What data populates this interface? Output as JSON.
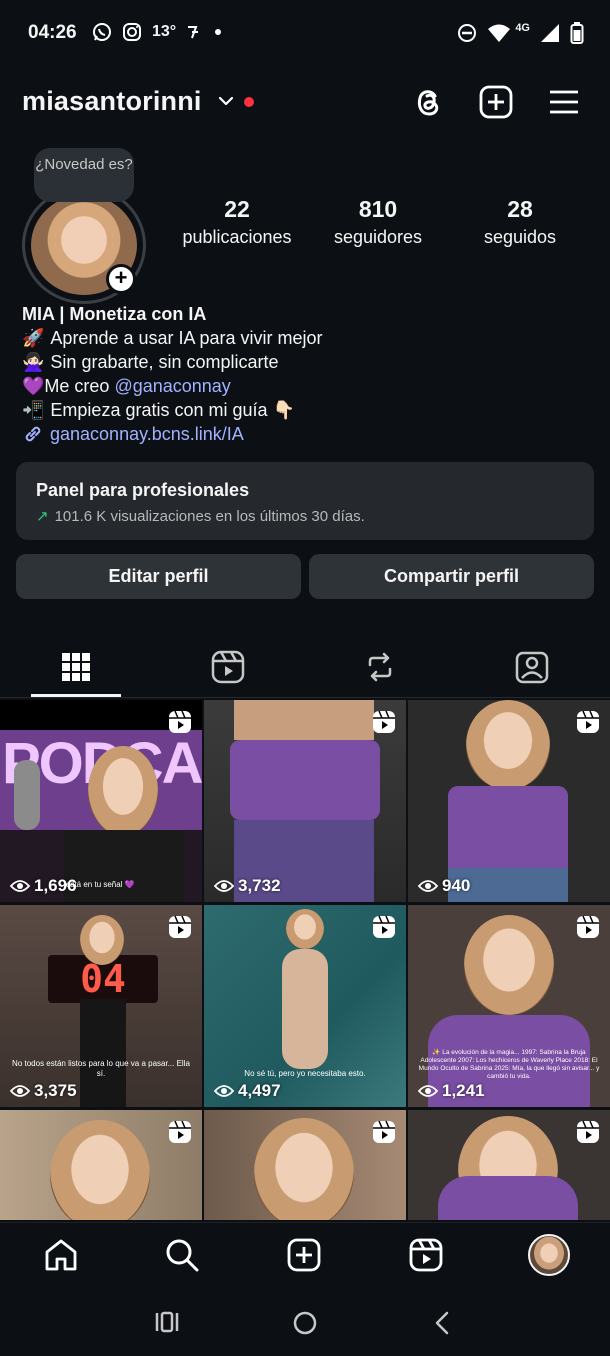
{
  "status_bar": {
    "time": "04:26",
    "temperature": "13°",
    "network": "4G",
    "icons": [
      "whatsapp-icon",
      "instagram-icon",
      "notification-icon",
      "dot-icon",
      "dnd-icon",
      "wifi-icon",
      "signal-icon",
      "battery-icon"
    ]
  },
  "header": {
    "username": "miasantorinni",
    "icons": [
      "threads-icon",
      "new-post-icon",
      "menu-icon"
    ]
  },
  "profile": {
    "note_bubble": "¿Novedad es?",
    "stats": [
      {
        "value": "22",
        "label": "publicaciones"
      },
      {
        "value": "810",
        "label": "seguidores"
      },
      {
        "value": "28",
        "label": "seguidos"
      }
    ],
    "bio": {
      "name": "MIA | Monetiza con IA",
      "line1_emoji": "🚀",
      "line1": "Aprende a usar IA para vivir mejor",
      "line2_emoji": "🙅🏻‍♀️",
      "line2": "Sin grabarte, sin complicarte",
      "line3_emoji": "💜",
      "line3_prefix": "Me creo ",
      "line3_mention": "@ganaconnay",
      "line4_emoji": "📲",
      "line4": "Empieza gratis con mi guía 👇🏻",
      "link": "ganaconnay.bcns.link/IA"
    }
  },
  "panel": {
    "title": "Panel para profesionales",
    "subtitle": "101.6 K visualizaciones en los últimos 30 días."
  },
  "buttons": {
    "edit": "Editar perfil",
    "share": "Compartir perfil"
  },
  "tabs": [
    "grid-icon",
    "reels-icon",
    "reposts-icon",
    "tagged-icon"
  ],
  "grid": [
    {
      "views": "1,696",
      "caption": "está en tu señal 💜",
      "overlay_text": "PODCAN"
    },
    {
      "views": "3,732"
    },
    {
      "views": "940"
    },
    {
      "views": "3,375",
      "caption": "No todos están listos para lo que va a pasar... Ella sí.",
      "overlay_text": "04"
    },
    {
      "views": "4,497",
      "caption": "No sé tú, pero yo necesitaba esto."
    },
    {
      "views": "1,241",
      "caption": "✨ La evolución de la magia... 1997: Sabrina la Bruja Adolescente 2007: Los hechiceros de Waverly Place 2018: El Mundo Oculto de Sabrina 2025: Mía, la que llegó sin avisar... y cambió tu vida."
    },
    {
      "views": ""
    },
    {
      "views": ""
    },
    {
      "views": ""
    }
  ],
  "bottom_nav": [
    "home-icon",
    "search-icon",
    "create-icon",
    "reels-icon",
    "profile-avatar"
  ],
  "system_nav": [
    "recents-icon",
    "home-circle-icon",
    "back-icon"
  ]
}
